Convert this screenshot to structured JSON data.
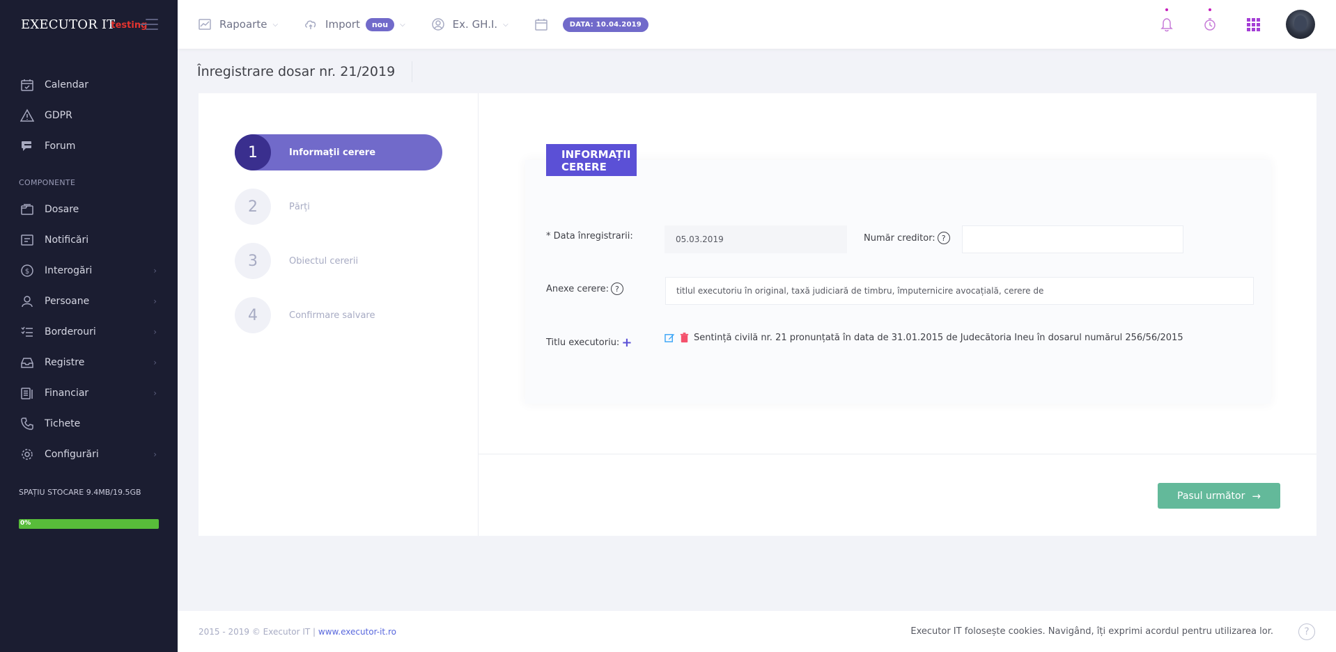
{
  "brand": {
    "logo": "EXECUTOR IT",
    "tag": "testing"
  },
  "sidebar": {
    "top_items": [
      {
        "label": "Calendar",
        "icon": "calendar-icon"
      },
      {
        "label": "GDPR",
        "icon": "warning-icon"
      },
      {
        "label": "Forum",
        "icon": "chat-icon"
      }
    ],
    "section_title": "COMPONENTE",
    "items": [
      {
        "label": "Dosare",
        "icon": "folder-icon",
        "submenu": false
      },
      {
        "label": "Notificări",
        "icon": "notification-icon",
        "submenu": false
      },
      {
        "label": "Interogări",
        "icon": "query-icon",
        "submenu": true
      },
      {
        "label": "Persoane",
        "icon": "user-icon",
        "submenu": true
      },
      {
        "label": "Borderouri",
        "icon": "list-icon",
        "submenu": true
      },
      {
        "label": "Registre",
        "icon": "inbox-icon",
        "submenu": true
      },
      {
        "label": "Financiar",
        "icon": "finance-icon",
        "submenu": true
      },
      {
        "label": "Tichete",
        "icon": "phone-icon",
        "submenu": false
      },
      {
        "label": "Configurări",
        "icon": "gear-icon",
        "submenu": true
      }
    ],
    "storage_label": "SPAȚIU STOCARE 9.4MB/19.5GB",
    "storage_percent_label": "0%",
    "storage_fraction": 0.0005
  },
  "header": {
    "rapoarte": "Rapoarte",
    "import": "Import",
    "import_badge": "nou",
    "ex": "Ex. GH.I.",
    "date_badge": "DATA: 10.04.2019"
  },
  "page": {
    "title": "Înregistrare dosar nr. 21/2019"
  },
  "wizard": {
    "steps": [
      {
        "num": "1",
        "label": "Informații cerere",
        "active": true
      },
      {
        "num": "2",
        "label": "Părți",
        "active": false
      },
      {
        "num": "3",
        "label": "Obiectul cererii",
        "active": false
      },
      {
        "num": "4",
        "label": "Confirmare salvare",
        "active": false
      }
    ]
  },
  "form": {
    "heading_line1": "INFORMAȚII",
    "heading_line2": "CERERE",
    "data_label": "* Data înregistrarii:",
    "data_value": "05.03.2019",
    "creditor_label": "Număr creditor:",
    "creditor_value": "",
    "anexe_label": "Anexe cerere:",
    "anexe_value": "titlul executoriu în original, taxă judiciară de timbru, împuternicire avocațială, cerere de",
    "titlu_label": "Titlu executoriu:",
    "titlu_text": "Sentință civilă nr. 21 pronunțată în data de 31.01.2015 de Judecătoria Ineu în dosarul numărul 256/56/2015",
    "help_glyph": "?",
    "plus_glyph": "+"
  },
  "actions": {
    "next_label": "Pasul următor",
    "next_arrow": "→"
  },
  "footer": {
    "copyright": "2015 - 2019 © Executor IT | ",
    "link": "www.executor-it.ro",
    "cookies": "Executor IT folosește cookies. Navigând, îți exprimi acordul pentru utilizarea lor.",
    "help_glyph": "?"
  },
  "colors": {
    "accent": "#716aca",
    "heading": "#5b50d6",
    "success": "#63b99a",
    "sidebar": "#1b1d31",
    "storage": "#58bc3a"
  }
}
